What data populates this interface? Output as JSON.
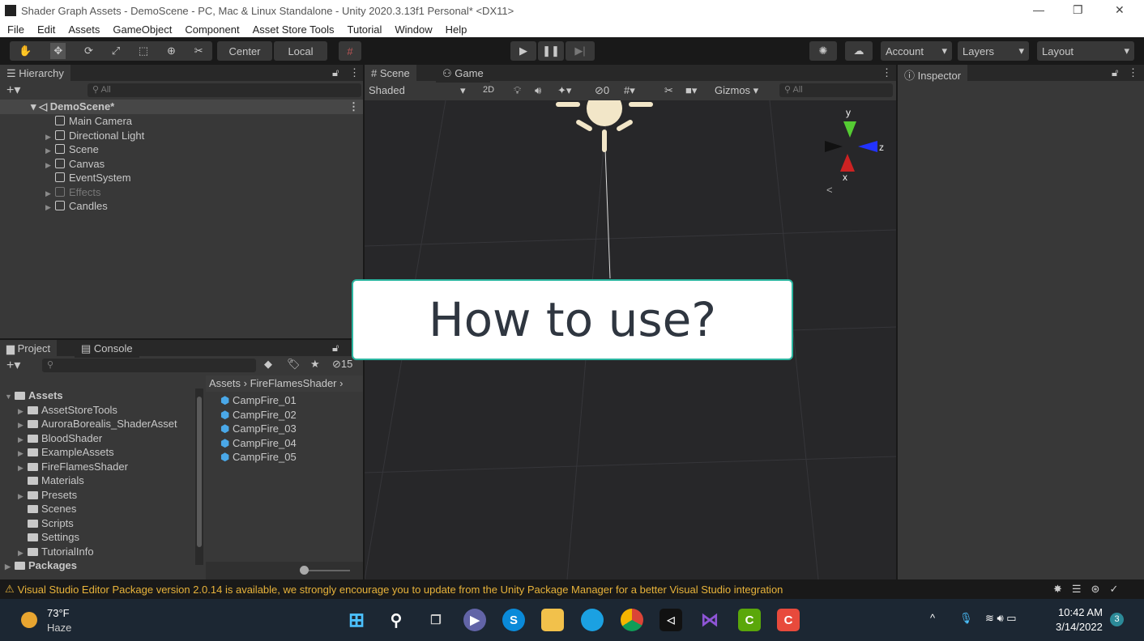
{
  "window": {
    "title": "Shader Graph Assets - DemoScene - PC, Mac & Linux Standalone - Unity 2020.3.13f1 Personal* <DX11>",
    "minimize": "—",
    "restore": "❐",
    "close": "✕"
  },
  "menu": [
    "File",
    "Edit",
    "Assets",
    "GameObject",
    "Component",
    "Asset Store Tools",
    "Tutorial",
    "Window",
    "Help"
  ],
  "toolbar": {
    "center": "Center",
    "local": "Local",
    "account": "Account",
    "layers": "Layers",
    "layout": "Layout"
  },
  "hierarchy": {
    "title": "Hierarchy",
    "search_placeholder": "All",
    "scene": "DemoScene*",
    "items": [
      "Main Camera",
      "Directional Light",
      "Scene",
      "Canvas",
      "EventSystem",
      "Effects",
      "Candles"
    ]
  },
  "sceneview": {
    "tab_scene": "Scene",
    "tab_game": "Game",
    "shading": "Shaded",
    "mode_2d": "2D",
    "hidden_count": "0",
    "gizmos": "Gizmos",
    "search_placeholder": "All",
    "axis_y": "y",
    "axis_z": "z",
    "axis_x": "x"
  },
  "overlay": {
    "text": "How to use?"
  },
  "inspector": {
    "title": "Inspector"
  },
  "project": {
    "tab_project": "Project",
    "tab_console": "Console",
    "hidden_count": "15",
    "breadcrumb": [
      "Assets",
      "FireFlamesShader"
    ],
    "tree": [
      "Assets",
      "AssetStoreTools",
      "AuroraBorealis_ShaderAsset",
      "BloodShader",
      "ExampleAssets",
      "FireFlamesShader",
      "Materials",
      "Presets",
      "Scenes",
      "Scripts",
      "Settings",
      "TutorialInfo",
      "Packages"
    ],
    "files": [
      "CampFire_01",
      "CampFire_02",
      "CampFire_03",
      "CampFire_04",
      "CampFire_05"
    ]
  },
  "status": {
    "message": "Visual Studio Editor Package version 2.0.14 is available, we strongly encourage you to update from the Unity Package Manager for a better Visual Studio integration"
  },
  "taskbar": {
    "temp": "73°F",
    "weather": "Haze",
    "time": "10:42 AM",
    "date": "3/14/2022",
    "notifications": "3"
  }
}
